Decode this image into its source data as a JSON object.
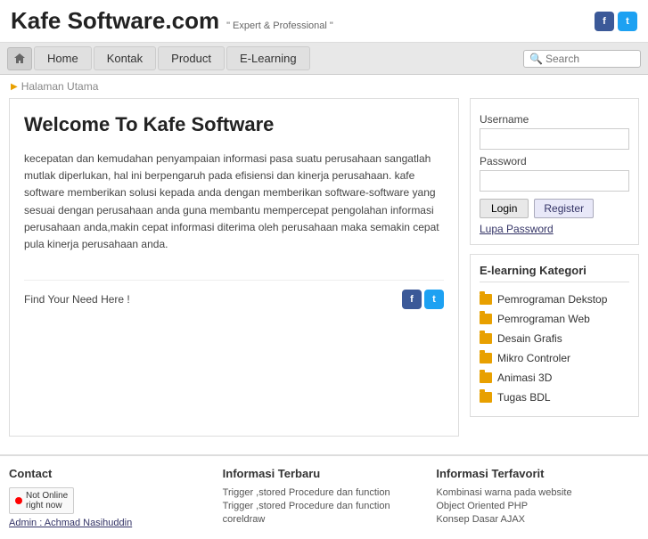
{
  "header": {
    "site_title": "Kafe Software.com",
    "tagline": "\" Expert & Professional \"",
    "fb_label": "f",
    "tw_label": "t"
  },
  "navbar": {
    "home_label": "Home",
    "items": [
      {
        "label": "Kontak"
      },
      {
        "label": "Product"
      },
      {
        "label": "E-Learning"
      }
    ],
    "search_placeholder": "Search"
  },
  "breadcrumb": {
    "text": "Halaman Utama"
  },
  "content": {
    "welcome_title": "Welcome To Kafe Software",
    "welcome_text": "kecepatan dan kemudahan penyampaian informasi pasa suatu perusahaan sangatlah mutlak diperlukan, hal ini berpengaruh pada efisiensi dan kinerja perusahaan. kafe software memberikan solusi kepada anda dengan memberikan software-software yang sesuai dengan perusahaan anda guna membantu mempercepat pengolahan informasi perusahaan anda,makin cepat informasi diterima oleh perusahaan maka semakin cepat pula kinerja perusahaan anda.",
    "find_need": "Find Your Need Here !"
  },
  "sidebar": {
    "login": {
      "username_label": "Username",
      "password_label": "Password",
      "login_btn": "Login",
      "register_btn": "Register",
      "forgot_label": "Lupa Password"
    },
    "elearning": {
      "title": "E-learning Kategori",
      "items": [
        {
          "label": "Pemrograman Dekstop"
        },
        {
          "label": "Pemrograman Web"
        },
        {
          "label": "Desain Grafis"
        },
        {
          "label": "Mikro Controler"
        },
        {
          "label": "Animasi 3D"
        },
        {
          "label": "Tugas BDL"
        }
      ]
    }
  },
  "footer": {
    "contact": {
      "title": "Contact",
      "not_online": "Not Online",
      "right_now": "right now",
      "admin_link": "Admin : Achmad Nasihuddin"
    },
    "informasi_terbaru": {
      "title": "Informasi Terbaru",
      "items": [
        {
          "label": "Trigger ,stored Procedure dan function"
        },
        {
          "label": "Trigger ,stored Procedure dan function"
        },
        {
          "label": "coreldraw"
        }
      ]
    },
    "informasi_terfavorit": {
      "title": "Informasi Terfavorit",
      "items": [
        {
          "label": "Kombinasi warna pada website"
        },
        {
          "label": "Object Oriented PHP"
        },
        {
          "label": "Konsep Dasar AJAX"
        }
      ]
    }
  }
}
